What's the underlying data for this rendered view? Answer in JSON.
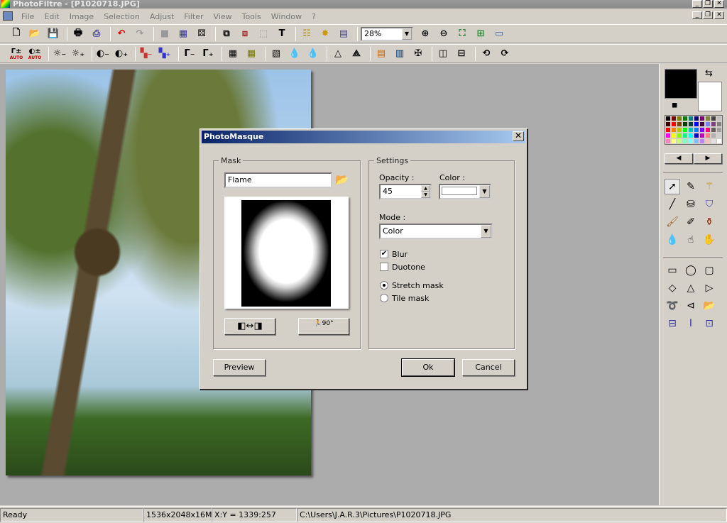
{
  "app": {
    "title": "PhotoFiltre - [P1020718.JPG]"
  },
  "menu": [
    "File",
    "Edit",
    "Image",
    "Selection",
    "Adjust",
    "Filter",
    "View",
    "Tools",
    "Window",
    "?"
  ],
  "toolbar": {
    "zoom": "28%",
    "auto_label": "AUTO"
  },
  "dialog": {
    "title": "PhotoMasque",
    "mask": {
      "legend": "Mask",
      "name": "Flame"
    },
    "settings": {
      "legend": "Settings",
      "opacity_label": "Opacity :",
      "opacity": "45",
      "color_label": "Color :",
      "color_value": "#ffffff",
      "mode_label": "Mode :",
      "mode": "Color",
      "blur_label": "Blur",
      "blur": true,
      "duotone_label": "Duotone",
      "duotone": false,
      "stretch_label": "Stretch mask",
      "tile_label": "Tile mask",
      "selected_fit": "Stretch mask"
    },
    "rotate_label": "90°",
    "preview": "Preview",
    "ok": "Ok",
    "cancel": "Cancel"
  },
  "colors": {
    "foreground": "#000000",
    "background": "#ffffff",
    "palette": [
      "#000000",
      "#800000",
      "#808000",
      "#008000",
      "#008080",
      "#000080",
      "#800080",
      "#808040",
      "#404040",
      "#c0c0c0",
      "#400000",
      "#ff0000",
      "#804000",
      "#004000",
      "#004040",
      "#0000ff",
      "#400040",
      "#8080ff",
      "#804080",
      "#808080",
      "#ff0000",
      "#ff8000",
      "#c0c000",
      "#00ff00",
      "#00c0c0",
      "#0080ff",
      "#8000ff",
      "#ff0080",
      "#606060",
      "#a0a0a0",
      "#ff00ff",
      "#ffff00",
      "#80ff00",
      "#00ff80",
      "#00ffff",
      "#0000c0",
      "#c000c0",
      "#ff8080",
      "#b0b0b0",
      "#d0d0d0",
      "#ff80c0",
      "#ffff80",
      "#c0ff80",
      "#80ffc0",
      "#80ffff",
      "#80c0ff",
      "#c080ff",
      "#ffc0c0",
      "#e0e0e0",
      "#ffffff"
    ]
  },
  "status": {
    "text": "Ready",
    "size": "1536x2048x16M",
    "coords": "X:Y = 1339:257",
    "path": "C:\\Users\\J.A.R.3\\Pictures\\P1020718.JPG"
  }
}
